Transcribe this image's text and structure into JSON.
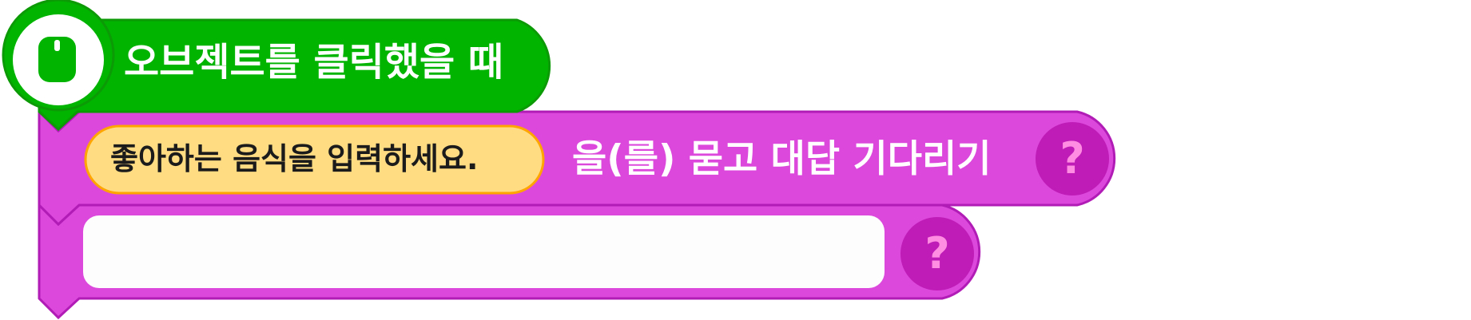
{
  "colors": {
    "hat_fill": "#00b400",
    "hat_border": "#0c9a06",
    "start_icon_fill": "#00b400",
    "block_fill": "#dc48dc",
    "block_border": "#b11cb6",
    "help_circle": "#bf1bb6",
    "help_glyph": "#ff8ee2",
    "string_fill": "#ffdb82",
    "string_border": "#ffa500",
    "answer_field_fill": "#fdfdfd",
    "text_white": "#ffffff",
    "text_dark": "#1b1b1b"
  },
  "hat_block": {
    "icon": "object-click-icon",
    "label": "오브젝트를 클릭했을 때"
  },
  "ask_block": {
    "question_value": "좋아하는 음식을 입력하세요.",
    "label": "을(를) 묻고 대답 기다리기",
    "help_icon": "question-mark-icon",
    "help_glyph": "?"
  },
  "answer_block": {
    "input_value": "",
    "help_icon": "question-mark-icon",
    "help_glyph": "?"
  }
}
